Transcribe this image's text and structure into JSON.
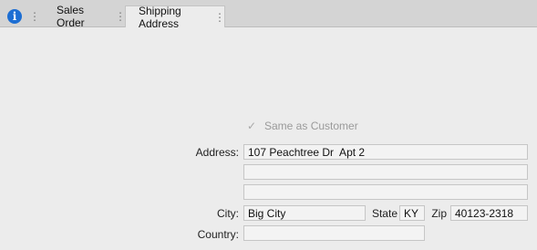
{
  "tabs": {
    "info": {
      "icon": "info-icon",
      "glyph": "i"
    },
    "sales_order": {
      "label": "Sales Order"
    },
    "shipping_address": {
      "label": "Shipping Address"
    },
    "grip_glyph": "⋮"
  },
  "form": {
    "same_as_customer": {
      "checked": true,
      "check_glyph": "✓",
      "label": "Same as Customer"
    },
    "address_label": "Address:",
    "address_line1": "107 Peachtree Dr  Apt 2",
    "address_line2": "",
    "address_line3": "",
    "city_label": "City:",
    "city": "Big City",
    "state_label": "State",
    "state": "KY",
    "zip_label": "Zip",
    "zip": "40123-2318",
    "country_label": "Country:",
    "country": ""
  },
  "colors": {
    "accent": "#1d6ed3",
    "background": "#ececec",
    "tabbar": "#d4d4d4"
  }
}
